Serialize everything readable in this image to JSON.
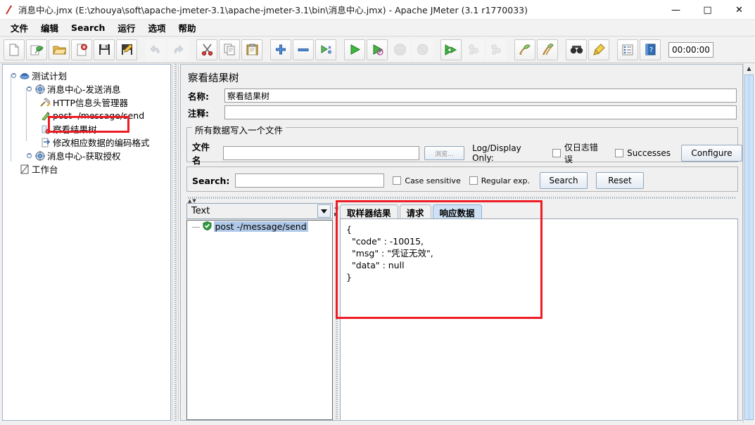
{
  "window": {
    "title": "消息中心.jmx (E:\\zhouya\\soft\\apache-jmeter-3.1\\apache-jmeter-3.1\\bin\\消息中心.jmx) - Apache JMeter (3.1 r1770033)",
    "minimize": "—",
    "maximize": "□",
    "close": "✕",
    "app_icon": "jmeter-feather-icon"
  },
  "menu": {
    "items": [
      {
        "label": "文件",
        "name": "menu-file"
      },
      {
        "label": "编辑",
        "name": "menu-edit"
      },
      {
        "label": "Search",
        "name": "menu-search"
      },
      {
        "label": "运行",
        "name": "menu-run"
      },
      {
        "label": "选项",
        "name": "menu-options"
      },
      {
        "label": "帮助",
        "name": "menu-help"
      }
    ]
  },
  "toolbar": {
    "timer": "00:00:00",
    "buttons": [
      {
        "name": "new-icon",
        "enabled": true
      },
      {
        "name": "templates-icon",
        "enabled": true
      },
      {
        "name": "open-icon",
        "enabled": true
      },
      {
        "name": "close-icon",
        "enabled": true
      },
      {
        "name": "save-icon",
        "enabled": true
      },
      {
        "name": "save-as-icon",
        "enabled": true
      },
      {
        "name": "undo-icon",
        "enabled": false
      },
      {
        "name": "redo-icon",
        "enabled": false
      },
      {
        "name": "cut-icon",
        "enabled": true
      },
      {
        "name": "copy-icon",
        "enabled": true
      },
      {
        "name": "paste-icon",
        "enabled": true
      },
      {
        "name": "expand-all-icon",
        "enabled": true
      },
      {
        "name": "collapse-all-icon",
        "enabled": true
      },
      {
        "name": "toggle-icon",
        "enabled": true
      },
      {
        "name": "start-icon",
        "enabled": true
      },
      {
        "name": "start-no-pause-icon",
        "enabled": true
      },
      {
        "name": "stop-icon",
        "enabled": false
      },
      {
        "name": "shutdown-icon",
        "enabled": false
      },
      {
        "name": "remote-start-all-icon",
        "enabled": true
      },
      {
        "name": "remote-stop-all-icon",
        "enabled": false
      },
      {
        "name": "remote-shutdown-all-icon",
        "enabled": false
      },
      {
        "name": "clear-icon",
        "enabled": true
      },
      {
        "name": "clear-all-icon",
        "enabled": true
      },
      {
        "name": "search-icon",
        "enabled": true
      },
      {
        "name": "search-reset-icon",
        "enabled": true
      },
      {
        "name": "function-helper-icon",
        "enabled": true
      },
      {
        "name": "help-icon",
        "enabled": true
      }
    ]
  },
  "tree": {
    "nodes": [
      {
        "label": "测试计划",
        "icon": "test-plan-icon",
        "depth": 0,
        "name": "tree-node-test-plan"
      },
      {
        "label": "消息中心-发送消息",
        "icon": "thread-group-icon",
        "depth": 1,
        "name": "tree-node-thread-group-send"
      },
      {
        "label": "HTTP信息头管理器",
        "icon": "header-manager-icon",
        "depth": 2,
        "name": "tree-node-header-manager"
      },
      {
        "label": "post -/message/send",
        "icon": "http-request-icon",
        "depth": 2,
        "name": "tree-node-http-request"
      },
      {
        "label": "察看结果树",
        "icon": "view-results-tree-icon",
        "depth": 2,
        "selected": true,
        "name": "tree-node-view-results-tree"
      },
      {
        "label": "修改相应数据的编码格式",
        "icon": "post-processor-icon",
        "depth": 2,
        "name": "tree-node-post-processor"
      },
      {
        "label": "消息中心-获取授权",
        "icon": "thread-group-icon",
        "depth": 1,
        "name": "tree-node-thread-group-auth"
      },
      {
        "label": "工作台",
        "icon": "workbench-icon",
        "depth": 0,
        "name": "tree-node-workbench"
      }
    ]
  },
  "editor": {
    "panel_title": "察看结果树",
    "name_label": "名称:",
    "name_value": "察看结果树",
    "comment_label": "注释:",
    "comment_value": "",
    "file_group_legend": "所有数据写入一个文件",
    "filename_label": "文件名",
    "filename_value": "",
    "browse_button": "浏览...",
    "log_display_label": "Log/Display Only:",
    "errors_only_label": "仅日志错误",
    "successes_label": "Successes",
    "configure_button": "Configure",
    "search_label": "Search:",
    "search_value": "",
    "case_sensitive_label": "Case sensitive",
    "regular_exp_label": "Regular exp.",
    "search_button": "Search",
    "reset_button": "Reset"
  },
  "results": {
    "render_selector": "Text",
    "items": [
      {
        "label": "post -/message/send",
        "status": "success",
        "name": "result-item-post-message-send"
      }
    ],
    "tabs": [
      {
        "label": "取样器结果",
        "active": false,
        "name": "tab-sampler-result"
      },
      {
        "label": "请求",
        "active": false,
        "name": "tab-request"
      },
      {
        "label": "响应数据",
        "active": true,
        "name": "tab-response-data"
      }
    ],
    "response_body": "{\n  \"code\" : -10015,\n  \"msg\" : \"凭证无效\",\n  \"data\" : null\n}"
  },
  "annotations": {
    "color": "#ee1c24",
    "boxes": [
      {
        "name": "annotation-box-tree-node",
        "target": "察看结果树"
      },
      {
        "name": "annotation-box-response",
        "target": "响应数据"
      }
    ]
  }
}
